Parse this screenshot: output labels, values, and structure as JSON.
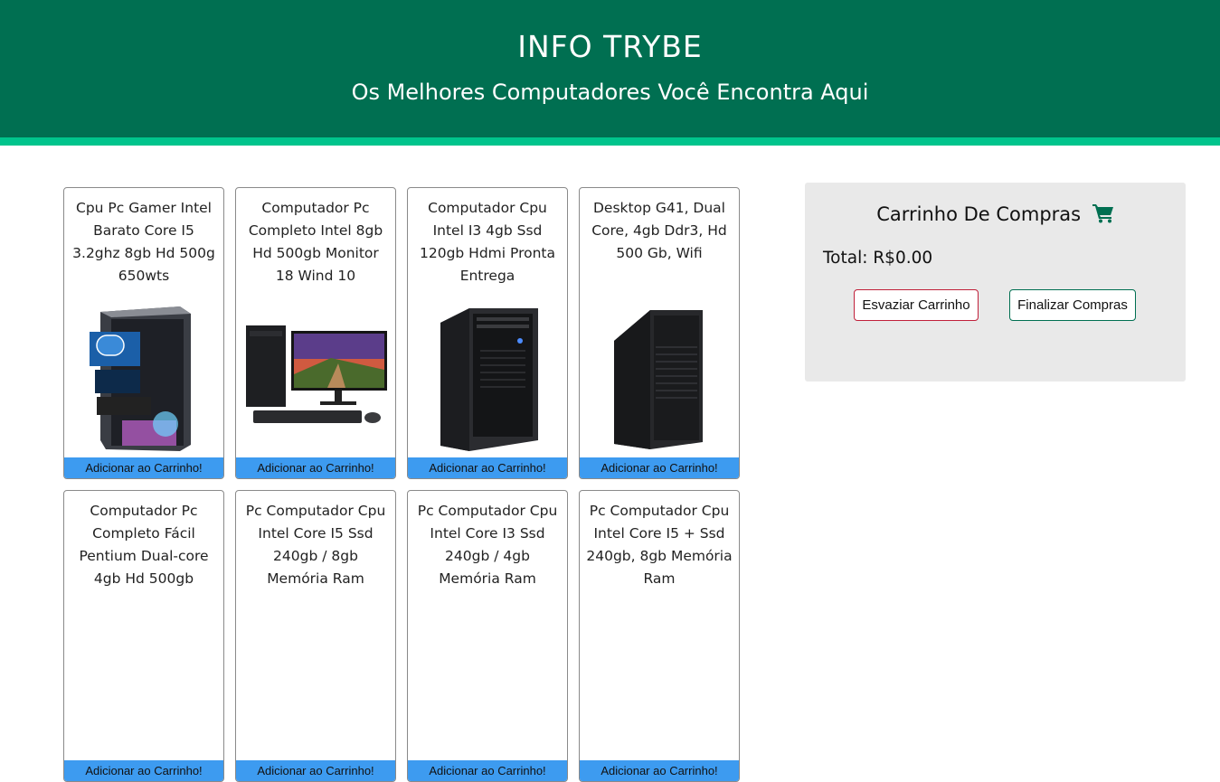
{
  "header": {
    "title": "INFO TRYBE",
    "subtitle": "Os Melhores Computadores Você Encontra Aqui",
    "bg_color": "#006f51",
    "stripe_color": "#00c48c"
  },
  "products": [
    {
      "name": "Cpu Pc Gamer Intel Barato Core I5 3.2ghz 8gb Hd 500g 650wts",
      "image_icon": "gamer-pc-tower-icon",
      "button": "Adicionar ao Carrinho!"
    },
    {
      "name": "Computador Pc Completo Intel 8gb Hd 500gb Monitor 18 Wind 10",
      "image_icon": "desktop-set-icon",
      "button": "Adicionar ao Carrinho!"
    },
    {
      "name": "Computador Cpu Intel I3 4gb Ssd 120gb Hdmi Pronta Entrega",
      "image_icon": "pc-tower-icon",
      "button": "Adicionar ao Carrinho!"
    },
    {
      "name": "Desktop G41, Dual Core, 4gb Ddr3, Hd 500 Gb, Wifi",
      "image_icon": "pc-tower-icon",
      "button": "Adicionar ao Carrinho!"
    },
    {
      "name": "Computador Pc Completo Fácil Pentium Dual-core 4gb Hd 500gb",
      "image_icon": "desktop-set-icon",
      "button": "Adicionar ao Carrinho!"
    },
    {
      "name": "Pc Computador Cpu Intel Core I5 Ssd 240gb / 8gb Memória Ram",
      "image_icon": "pc-tower-icon",
      "button": "Adicionar ao Carrinho!"
    },
    {
      "name": "Pc Computador Cpu Intel Core I3 Ssd 240gb / 4gb Memória Ram",
      "image_icon": "pc-tower-icon",
      "button": "Adicionar ao Carrinho!"
    },
    {
      "name": "Pc Computador Cpu Intel Core I5 + Ssd 240gb, 8gb Memória Ram",
      "image_icon": "pc-tower-icon",
      "button": "Adicionar ao Carrinho!"
    }
  ],
  "cart": {
    "title": "Carrinho De Compras",
    "icon": "shopping-cart-icon",
    "total_label": "Total: R$0.00",
    "empty_button": "Esvaziar Carrinho",
    "finish_button": "Finalizar Compras",
    "accent_color": "#006f51"
  },
  "add_button_color": "#3d9bf0"
}
